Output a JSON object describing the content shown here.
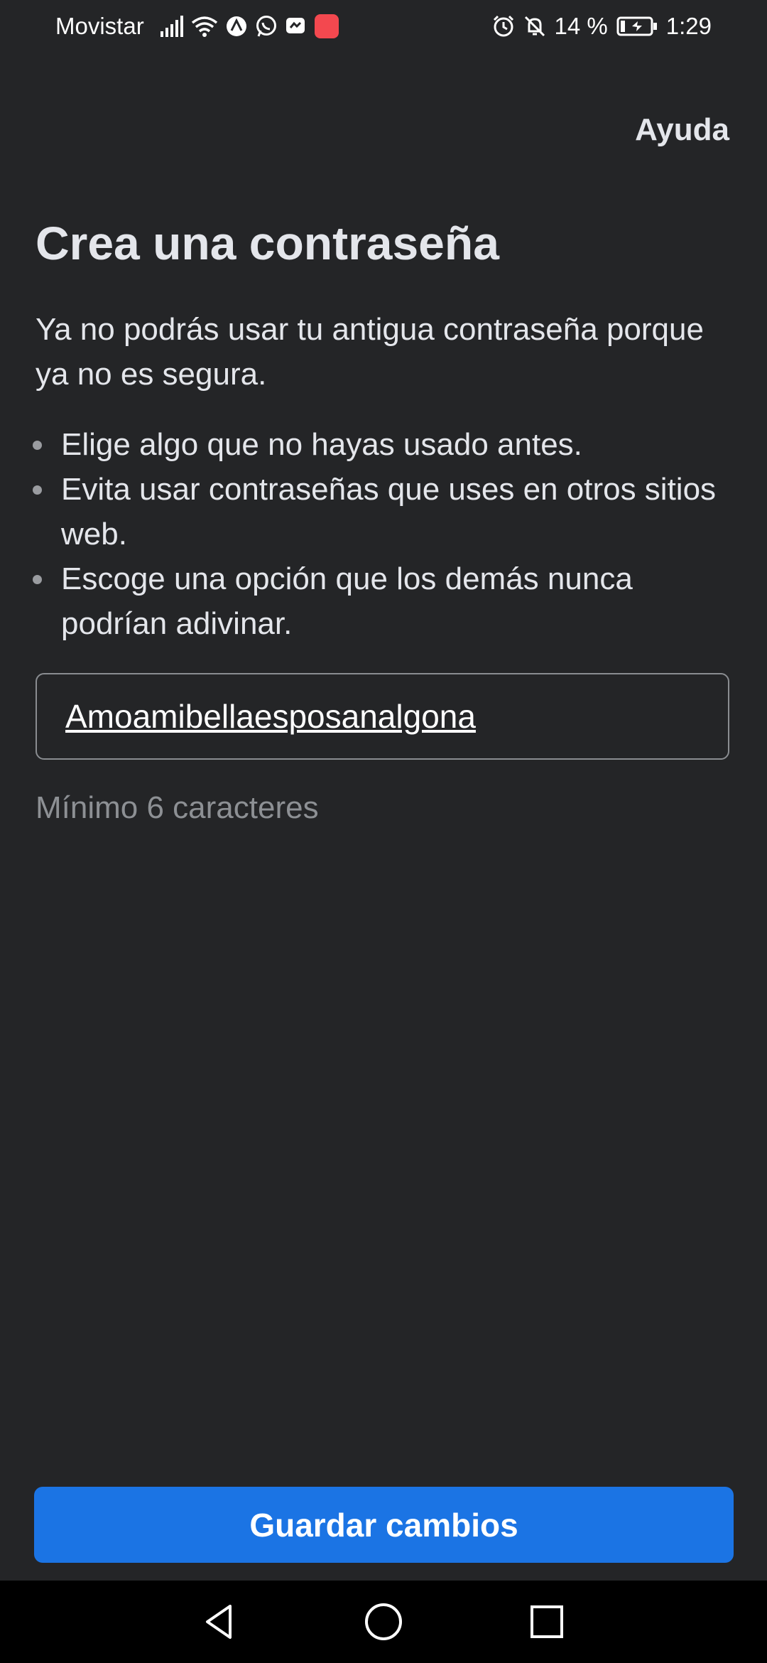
{
  "status_bar": {
    "carrier": "Movistar",
    "battery_percent": "14 %",
    "time": "1:29",
    "icons_left": [
      "signal-icon",
      "wifi-icon",
      "no-disturb-app-icon",
      "whatsapp-icon",
      "messenger-icon",
      "app-gallery-icon"
    ],
    "icons_right": [
      "alarm-icon",
      "notifications-off-icon",
      "battery-charging-icon"
    ]
  },
  "header": {
    "help_label": "Ayuda"
  },
  "main": {
    "title": "Crea una contraseña",
    "description": "Ya no podrás usar tu antigua contraseña porque ya no es segura.",
    "tips": [
      "Elige algo que no hayas usado antes.",
      "Evita usar contraseñas que uses en otros sitios web.",
      "Escoge una opción que los demás nunca podrían adivinar."
    ],
    "password_value": "Amoamibellaesposanalgona",
    "hint": "Mínimo 6 caracteres",
    "save_label": "Guardar cambios"
  },
  "nav_bar": {
    "buttons": [
      "back-icon",
      "home-icon",
      "recents-icon"
    ]
  },
  "colors": {
    "background": "#242527",
    "primary_button": "#1b74e4",
    "text": "#e4e6eb",
    "hint_text": "#8d9094"
  }
}
